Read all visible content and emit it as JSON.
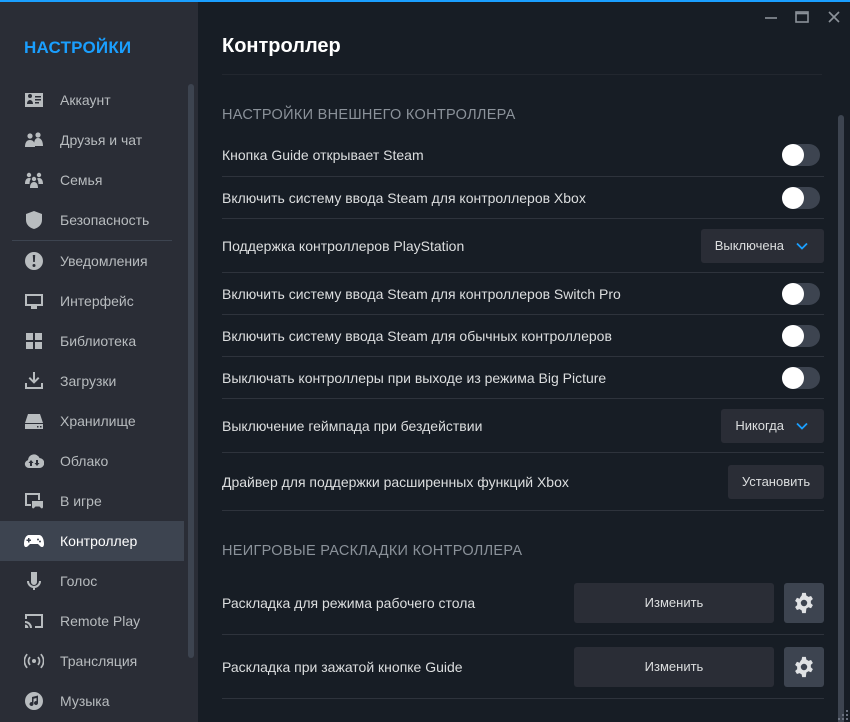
{
  "sidebar": {
    "title": "НАСТРОЙКИ",
    "items": [
      {
        "label": "Аккаунт",
        "icon": "account-card-icon"
      },
      {
        "label": "Друзья и чат",
        "icon": "friends-icon"
      },
      {
        "label": "Семья",
        "icon": "family-icon"
      },
      {
        "label": "Безопасность",
        "icon": "shield-icon"
      },
      {
        "label": "Уведомления",
        "icon": "notification-icon"
      },
      {
        "label": "Интерфейс",
        "icon": "monitor-icon"
      },
      {
        "label": "Библиотека",
        "icon": "library-grid-icon"
      },
      {
        "label": "Загрузки",
        "icon": "download-icon"
      },
      {
        "label": "Хранилище",
        "icon": "storage-drive-icon"
      },
      {
        "label": "Облако",
        "icon": "cloud-sync-icon"
      },
      {
        "label": "В игре",
        "icon": "in-game-icon"
      },
      {
        "label": "Контроллер",
        "icon": "gamepad-icon",
        "active": true
      },
      {
        "label": "Голос",
        "icon": "microphone-icon"
      },
      {
        "label": "Remote Play",
        "icon": "cast-icon"
      },
      {
        "label": "Трансляция",
        "icon": "broadcast-icon"
      },
      {
        "label": "Музыка",
        "icon": "music-icon"
      }
    ]
  },
  "window": {
    "minimize_icon": "minimize-icon",
    "maximize_icon": "maximize-icon",
    "close_icon": "close-icon"
  },
  "main": {
    "title": "Контроллер",
    "section1": {
      "heading": "НАСТРОЙКИ ВНЕШНЕГО КОНТРОЛЛЕРА",
      "rows": [
        {
          "label": "Кнопка Guide открывает Steam",
          "control": "toggle",
          "value": false
        },
        {
          "label": "Включить систему ввода Steam для контроллеров Xbox",
          "control": "toggle",
          "value": false
        },
        {
          "label": "Поддержка контроллеров PlayStation",
          "control": "dropdown",
          "value": "Выключена"
        },
        {
          "label": "Включить систему ввода Steam для контроллеров Switch Pro",
          "control": "toggle",
          "value": false
        },
        {
          "label": "Включить систему ввода Steam для обычных контроллеров",
          "control": "toggle",
          "value": false
        },
        {
          "label": "Выключать контроллеры при выходе из режима Big Picture",
          "control": "toggle",
          "value": false
        },
        {
          "label": "Выключение геймпада при бездействии",
          "control": "dropdown",
          "value": "Никогда"
        },
        {
          "label": "Драйвер для поддержки расширенных функций Xbox",
          "control": "button",
          "value": "Установить"
        }
      ]
    },
    "section2": {
      "heading": "НЕИГРОВЫЕ РАСКЛАДКИ КОНТРОЛЛЕРА",
      "rows": [
        {
          "label": "Раскладка для режима рабочего стола",
          "button": "Изменить"
        },
        {
          "label": "Раскладка при зажатой кнопке Guide",
          "button": "Изменить"
        }
      ]
    }
  },
  "colors": {
    "accent": "#1a9fff",
    "sidebar_bg": "#2a2d36",
    "main_bg": "#171d25",
    "active_item": "#3d4450"
  }
}
